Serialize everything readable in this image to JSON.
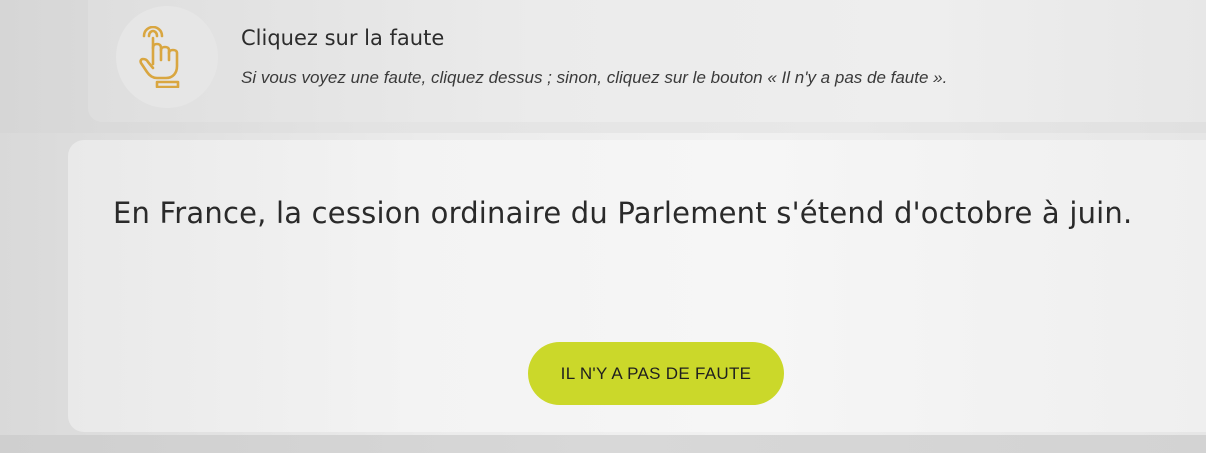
{
  "instruction": {
    "icon": "pointing-hand-icon",
    "title": "Cliquez sur la faute",
    "description": "Si vous voyez une faute, cliquez dessus ; sinon, cliquez sur le bouton « Il n'y a pas de faute »."
  },
  "exercise": {
    "sentence": "En France, la cession ordinaire du Parlement s'étend d'octobre à juin."
  },
  "actions": {
    "no_fault_label": "IL N'Y A PAS DE FAUTE"
  },
  "colors": {
    "accent": "#cbd82a",
    "icon_stroke": "#d9a640"
  }
}
